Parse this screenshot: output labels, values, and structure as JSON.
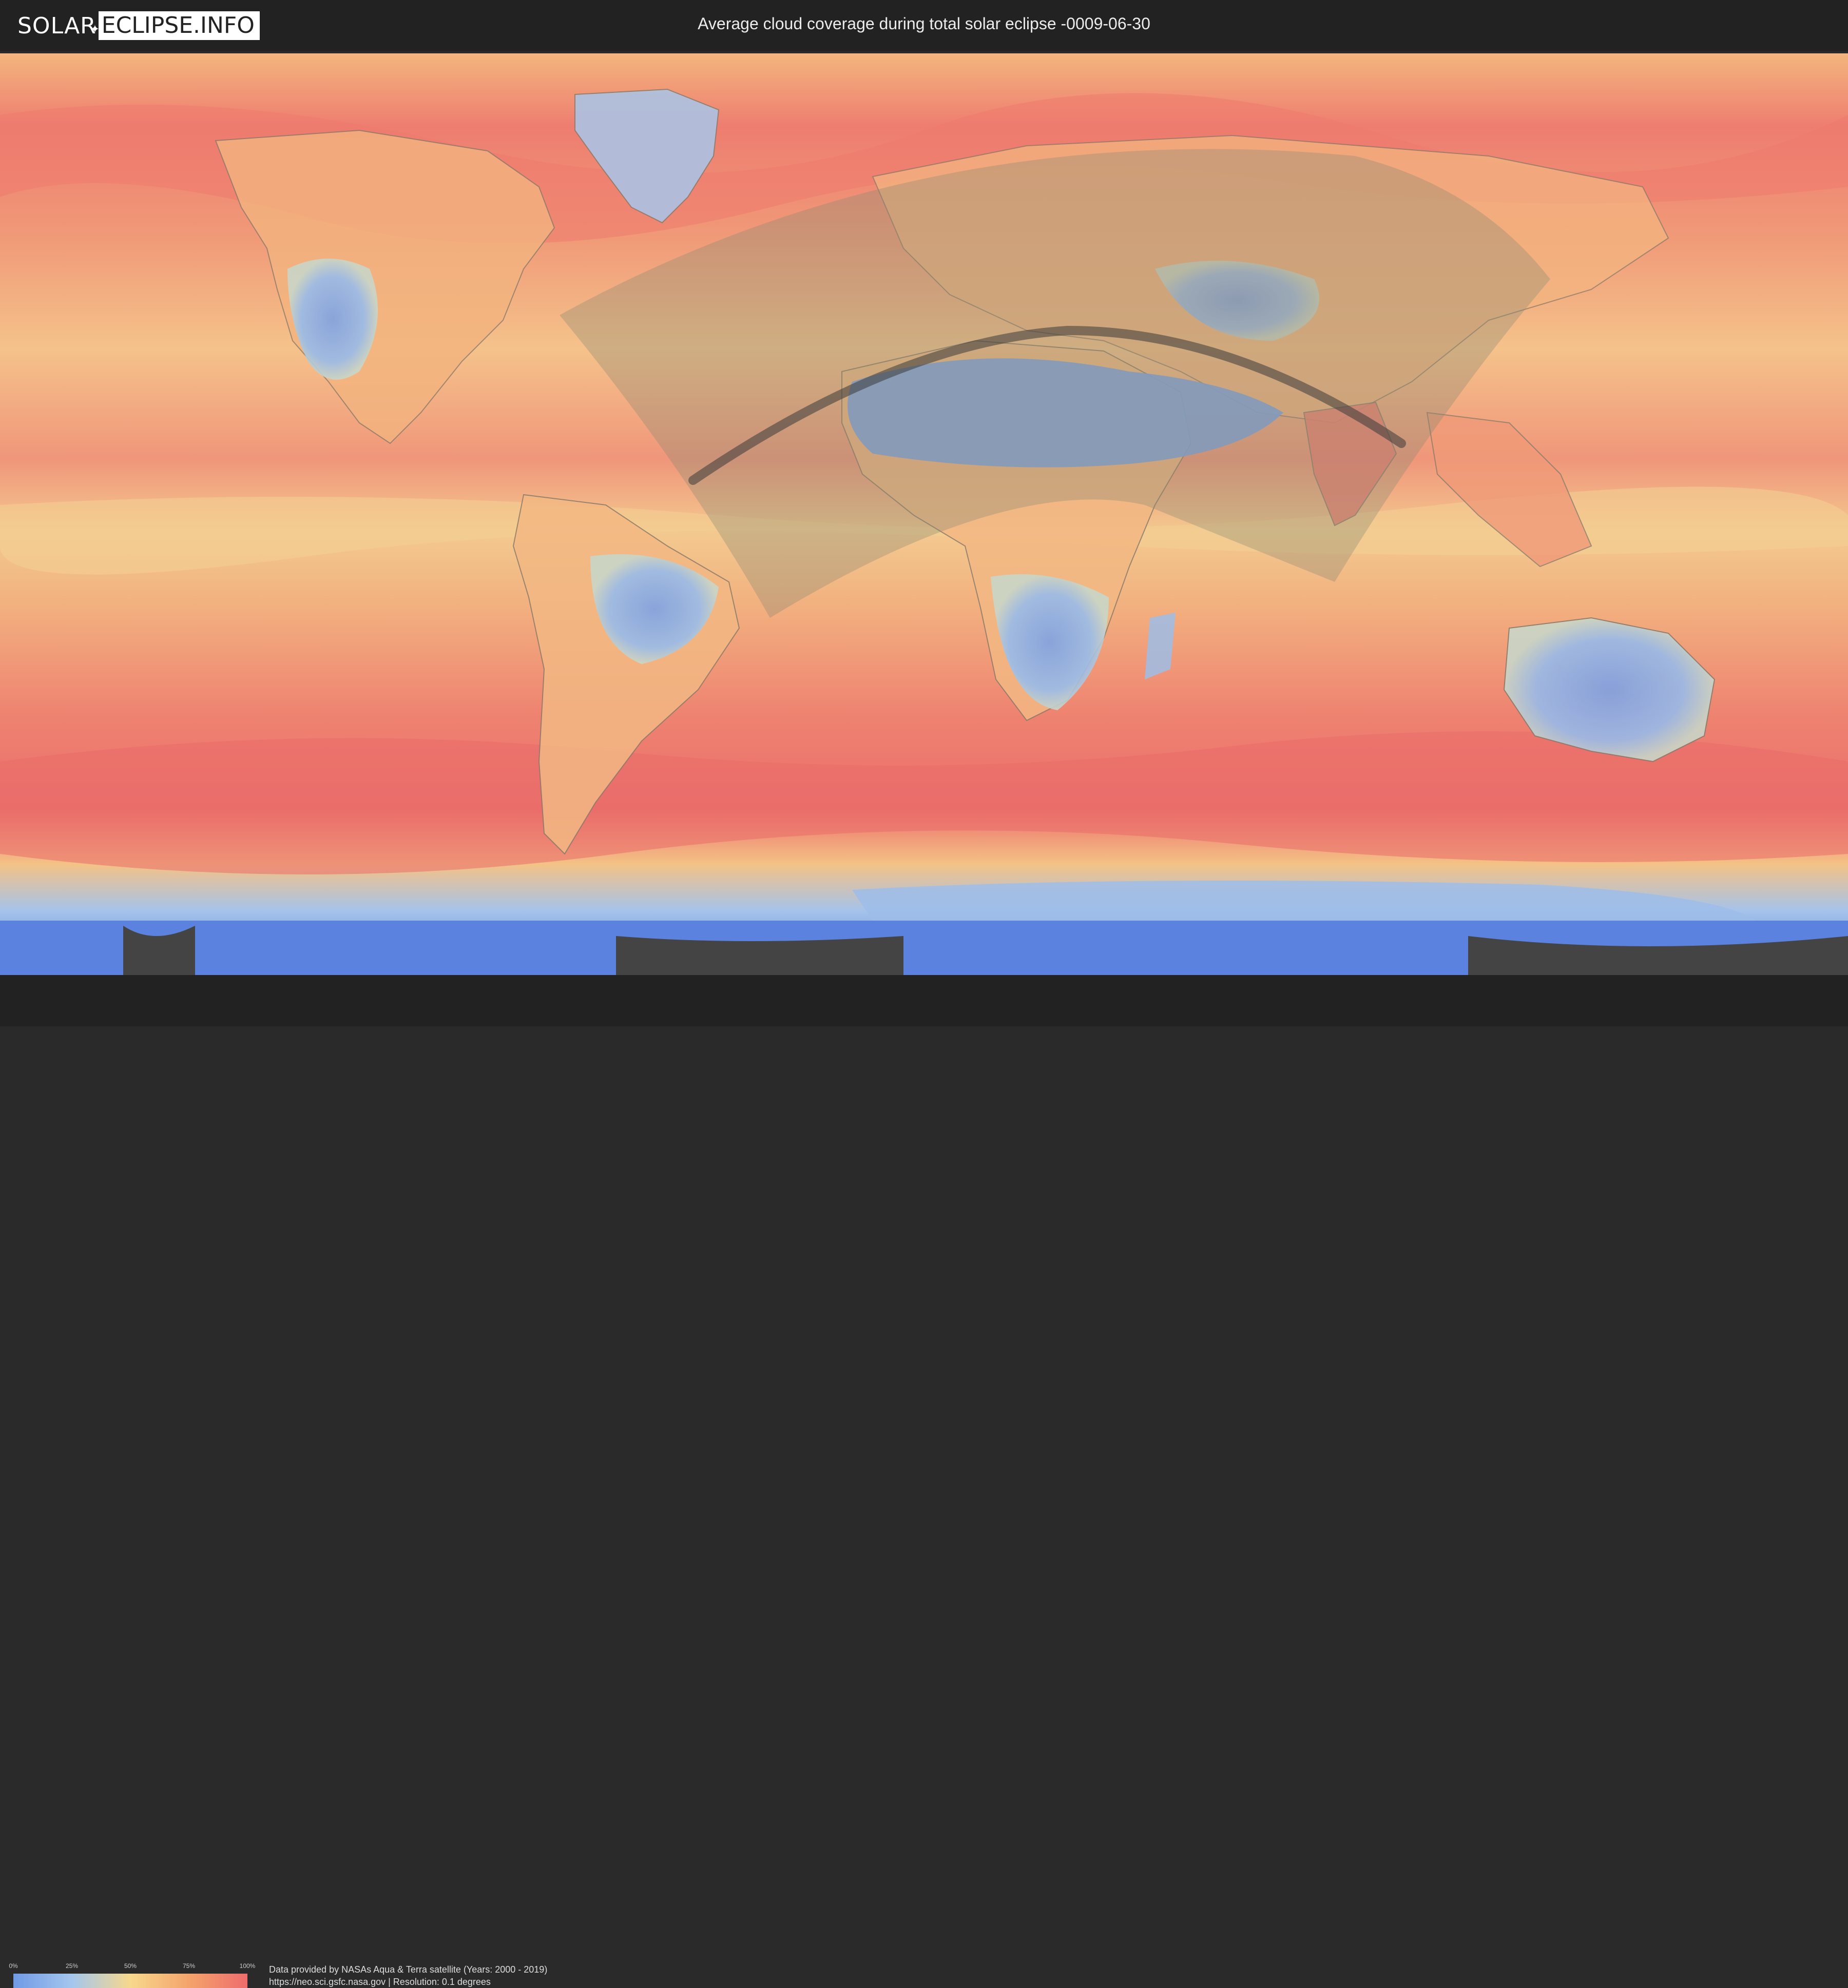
{
  "header": {
    "logo_left": "SOLAR",
    "logo_right": "ECLIPSE.INFO",
    "title": "Average cloud coverage during total solar eclipse -0009-06-30"
  },
  "legend": {
    "ticks": [
      "0%",
      "25%",
      "50%",
      "75%",
      "100%"
    ],
    "colors": [
      "#6f9ae6",
      "#a4c6ee",
      "#f7d88c",
      "#f4a46b",
      "#ee6c6c"
    ]
  },
  "footer": {
    "credit_line1": "Data provided by NASAs Aqua & Terra satellite (Years: 2000 - 2019)",
    "credit_line2": "https://neo.sci.gsfc.nasa.gov | Resolution: 0.1 degrees"
  },
  "map": {
    "ocean_cloud_color": "#ee7a6e",
    "land_clear_color": "#7fa4e2",
    "antarctica_color": "#5c82e0",
    "visibility_zone_color": "#8a8a72",
    "eclipse_path_color": "#3a3a3a"
  }
}
